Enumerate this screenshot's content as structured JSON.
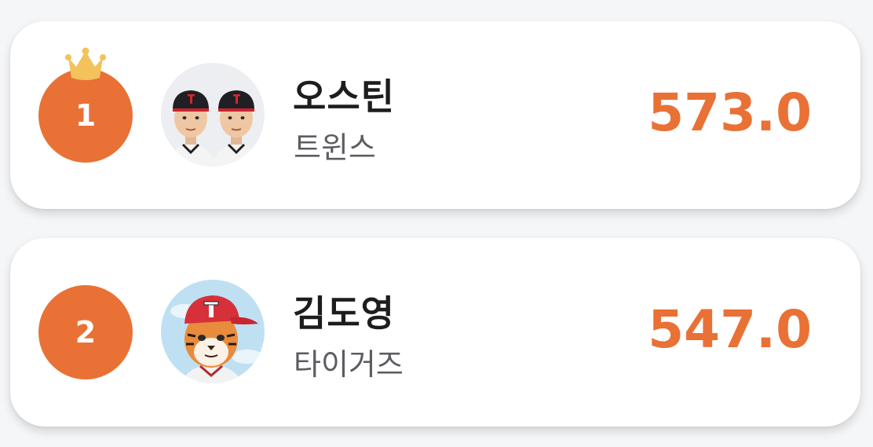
{
  "leaderboard": {
    "entries": [
      {
        "rank": "1",
        "name": "오스틴",
        "team": "트윈스",
        "score": "573.0",
        "avatar_icon": "twins-players-avatar",
        "crown_icon": "crown-icon"
      },
      {
        "rank": "2",
        "name": "김도영",
        "team": "타이거즈",
        "score": "547.0",
        "avatar_icon": "tiger-mascot-avatar"
      }
    ]
  },
  "colors": {
    "accent": "#e97135",
    "crown": "#f3c25a",
    "card_bg": "#ffffff",
    "page_bg": "#f5f6f8",
    "name_text": "#1d1d1f",
    "team_text": "#5c5c62"
  }
}
